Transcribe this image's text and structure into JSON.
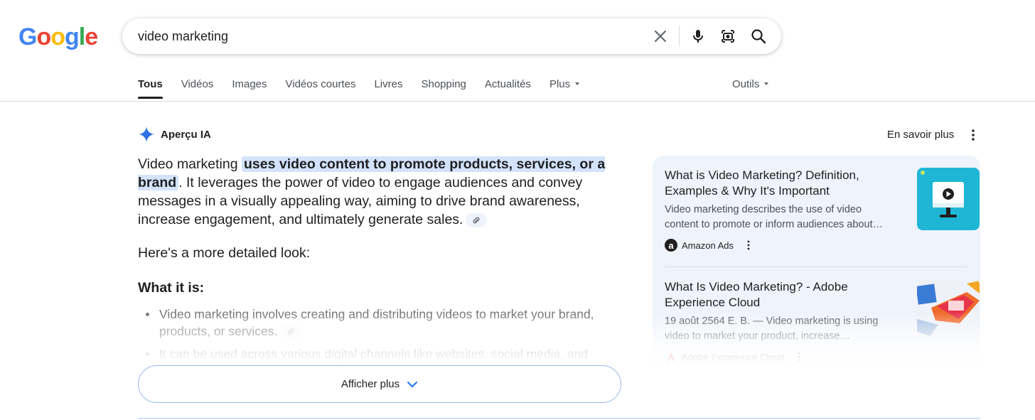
{
  "logo": {
    "letters": [
      "G",
      "o",
      "o",
      "g",
      "l",
      "e"
    ]
  },
  "search": {
    "value": "video marketing"
  },
  "tabs": [
    {
      "label": "Tous",
      "active": true
    },
    {
      "label": "Vidéos"
    },
    {
      "label": "Images"
    },
    {
      "label": "Vidéos courtes"
    },
    {
      "label": "Livres"
    },
    {
      "label": "Shopping"
    },
    {
      "label": "Actualités"
    },
    {
      "label": "Plus"
    }
  ],
  "tools_label": "Outils",
  "ai_overview": {
    "title": "Aperçu IA",
    "learn_more": "En savoir plus",
    "intro_prefix": "Video marketing ",
    "intro_highlight": "uses video content to promote products, services, or a brand",
    "intro_rest": ". It leverages the power of video to engage audiences and convey messages in a visually appealing way, aiming to drive brand awareness, increase engagement, and ultimately generate sales.",
    "detail_heading": "Here's a more detailed look:",
    "section_heading": "What it is:",
    "bullets": [
      "Video marketing involves creating and distributing videos to market your brand, products, or services.",
      "It can be used across various digital channels like websites, social media, and"
    ],
    "show_more": "Afficher plus"
  },
  "sources": [
    {
      "title": "What is Video Marketing? Definition, Examples & Why It's Important",
      "snippet": "Video marketing describes the use of video content to promote or inform audiences about…",
      "site": "Amazon Ads",
      "favicon": "a"
    },
    {
      "title": "What Is Video Marketing? - Adobe Experience Cloud",
      "snippet_line1": "19 août 2564 E. B. — Video marketing is using",
      "snippet_line2": "video to market your product, increase…",
      "site": "Adobe Experience Cloud"
    }
  ],
  "colors": {
    "accent": "#1a73e8",
    "highlight": "#d3e3fd",
    "panel": "#eff3fc"
  }
}
